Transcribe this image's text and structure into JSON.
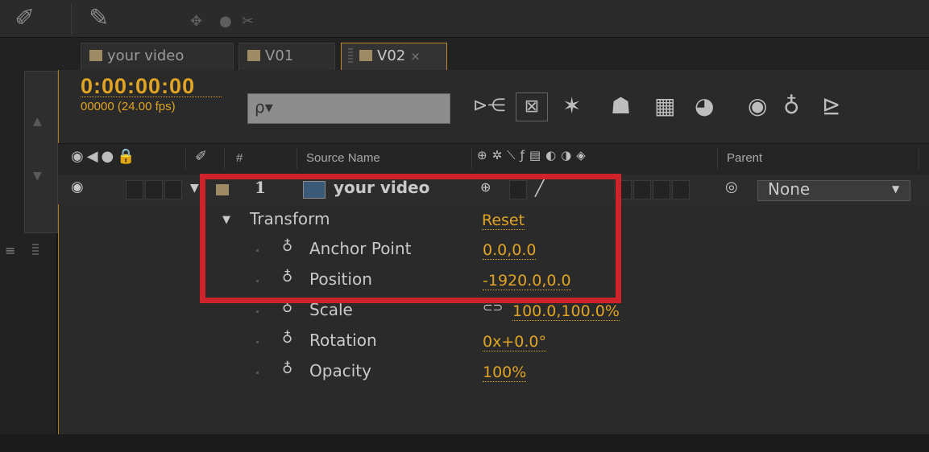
{
  "tabs": [
    {
      "label": "your video",
      "active": false
    },
    {
      "label": "V01",
      "active": false
    },
    {
      "label": "V02",
      "active": true
    }
  ],
  "timecode": {
    "value": "0:00:00:00",
    "frames": "00000 (24.00 fps)"
  },
  "search": {
    "placeholder": "ρ▾"
  },
  "columns": {
    "hash": "#",
    "source_name": "Source Name",
    "parent": "Parent"
  },
  "layer": {
    "number": "1",
    "name": "your video",
    "parent_value": "None"
  },
  "transform": {
    "label": "Transform",
    "reset_label": "Reset",
    "properties": [
      {
        "name": "Anchor Point",
        "value": "0.0,0.0"
      },
      {
        "name": "Position",
        "value": "-1920.0,0.0"
      },
      {
        "name": "Scale",
        "value": "100.0,100.0%"
      },
      {
        "name": "Rotation",
        "value": "0x+0.0°"
      },
      {
        "name": "Opacity",
        "value": "100%"
      }
    ]
  },
  "colors": {
    "accent": "#e0a425",
    "highlight_box": "#d0222a",
    "tab_swatch": "#9e8a63"
  }
}
